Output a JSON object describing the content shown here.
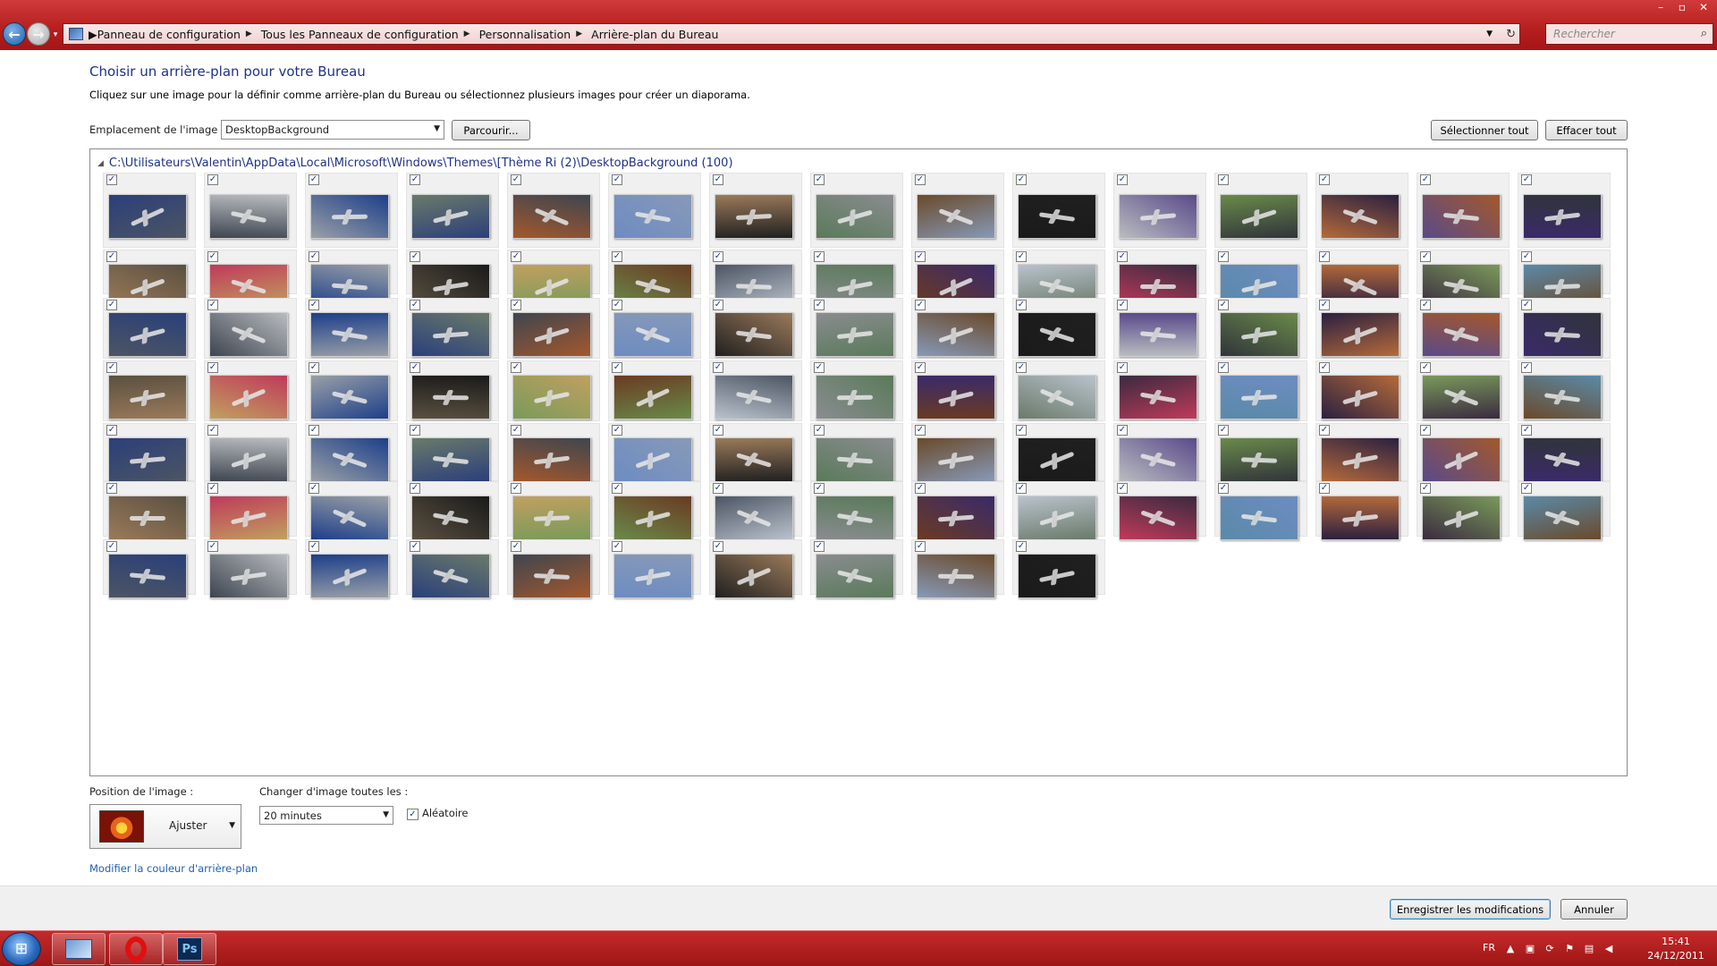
{
  "navbar": {
    "breadcrumb": [
      "Panneau de configuration",
      "Tous les Panneaux de configuration",
      "Personnalisation",
      "Arrière-plan du Bureau"
    ],
    "search_placeholder": "Rechercher"
  },
  "main": {
    "title": "Choisir un arrière-plan pour votre Bureau",
    "description": "Cliquez sur une image pour la définir comme arrière-plan du Bureau ou sélectionnez plusieurs images pour créer un diaporama.",
    "location_label": "Emplacement de l'image :",
    "location_value": "DesktopBackground",
    "browse_label": "Parcourir...",
    "select_all_label": "Sélectionner tout",
    "clear_all_label": "Effacer tout",
    "group_path": "C:\\Utilisateurs\\Valentin\\AppData\\Local\\Microsoft\\Windows\\Themes\\[Thème Ri (2)\\DesktopBackground (100)"
  },
  "options": {
    "position_label": "Position de l'image :",
    "position_value": "Ajuster",
    "interval_label": "Changer d'image toutes les :",
    "interval_value": "20 minutes",
    "shuffle_label": "Aléatoire",
    "shuffle_checked": true,
    "bgcolor_link": "Modifier la couleur d'arrière-plan"
  },
  "footer": {
    "save_label": "Enregistrer les modifications",
    "cancel_label": "Annuler"
  },
  "taskbar": {
    "lang": "FR",
    "time": "15:41",
    "date": "24/12/2011"
  },
  "thumbnails": {
    "rows": [
      15,
      15,
      15,
      15,
      15,
      15,
      10
    ],
    "all_checked": true,
    "palette": [
      "#4c5563",
      "#3e4550",
      "#9aa0a6",
      "#2b3f7a",
      "#a3582c",
      "#6d8cc2",
      "#202020",
      "#5a7a5a",
      "#8799b8",
      "#1a1a1a",
      "#b9bcc0",
      "#30343a",
      "#b56a3a",
      "#5a4a8a",
      "#3a2a6a",
      "#9a7a5a",
      "#c0a060",
      "#1d3f8a",
      "#5a5040",
      "#7a9a5a",
      "#6a8a4a",
      "#b9c2cc",
      "#8a8c90",
      "#6a3a22",
      "#6a7a6a",
      "#c03a5a",
      "#5a8aa8",
      "#2a2040",
      "#3a2a40",
      "#6a4a2a"
    ]
  }
}
